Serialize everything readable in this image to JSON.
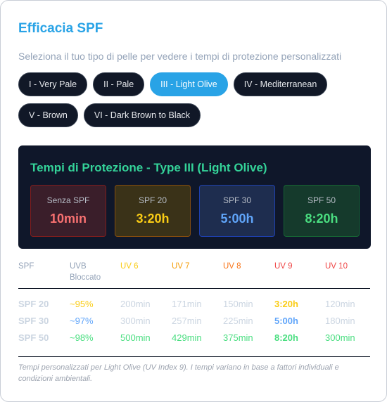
{
  "title": "Efficacia SPF",
  "subtitle": "Seleziona il tuo tipo di pelle per vedere i tempi di protezione personalizzati",
  "skin_types": {
    "row1": [
      "I - Very Pale",
      "II - Pale",
      "III - Light Olive",
      "IV - Mediterranean"
    ],
    "row2": [
      "V - Brown",
      "VI - Dark Brown to Black"
    ],
    "selected": "III - Light Olive"
  },
  "protection": {
    "title": "Tempi di Protezione - Type III (Light Olive)",
    "boxes": [
      {
        "label": "Senza SPF",
        "value": "10min"
      },
      {
        "label": "SPF 20",
        "value": "3:20h"
      },
      {
        "label": "SPF 30",
        "value": "5:00h"
      },
      {
        "label": "SPF 50",
        "value": "8:20h"
      }
    ]
  },
  "table": {
    "headers": [
      "SPF",
      "UVB Bloccato",
      "UV 6",
      "UV 7",
      "UV 8",
      "UV 9",
      "UV 10"
    ],
    "rows": [
      {
        "spf": "SPF 20",
        "uvb": "~95%",
        "uv6": "200min",
        "uv7": "171min",
        "uv8": "150min",
        "uv9": "3:20h",
        "uv10": "120min"
      },
      {
        "spf": "SPF 30",
        "uvb": "~97%",
        "uv6": "300min",
        "uv7": "257min",
        "uv8": "225min",
        "uv9": "5:00h",
        "uv10": "180min"
      },
      {
        "spf": "SPF 50",
        "uvb": "~98%",
        "uv6": "500min",
        "uv7": "429min",
        "uv8": "375min",
        "uv9": "8:20h",
        "uv10": "300min"
      }
    ]
  },
  "note": "Tempi personalizzati per Light Olive (UV Index 9). I tempi variano in base a fattori individuali e condizioni ambientali.",
  "colors": {
    "accent": "#29a3e6",
    "green": "#34d399",
    "yellow": "#facc15",
    "blue": "#60a5fa",
    "bright_green": "#4ade80",
    "red": "#f87171",
    "uv6": "#facc15",
    "uv7": "#f59e0b",
    "uv8": "#f97316",
    "uv9": "#ef4444",
    "uv10": "#ef4444",
    "muted": "#cbd5e1"
  }
}
